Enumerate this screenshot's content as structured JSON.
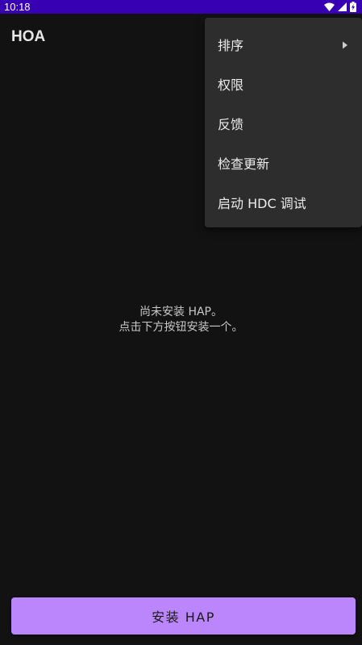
{
  "status_bar": {
    "time": "10:18",
    "icons": [
      "wifi-icon",
      "cell-signal-icon",
      "battery-charging-icon"
    ]
  },
  "app_bar": {
    "title": "HOA"
  },
  "empty_state": {
    "line1": "尚未安装 HAP。",
    "line2": "点击下方按钮安装一个。"
  },
  "overflow_menu": {
    "items": [
      {
        "label": "排序",
        "has_submenu": true
      },
      {
        "label": "权限"
      },
      {
        "label": "反馈"
      },
      {
        "label": "检查更新"
      },
      {
        "label": "启动 HDC 调试"
      }
    ]
  },
  "install_button": {
    "label": "安装 HAP"
  },
  "colors": {
    "status_bar": "#3700b3",
    "background": "#121212",
    "menu_background": "#2d2d2d",
    "accent": "#bb86fc"
  }
}
